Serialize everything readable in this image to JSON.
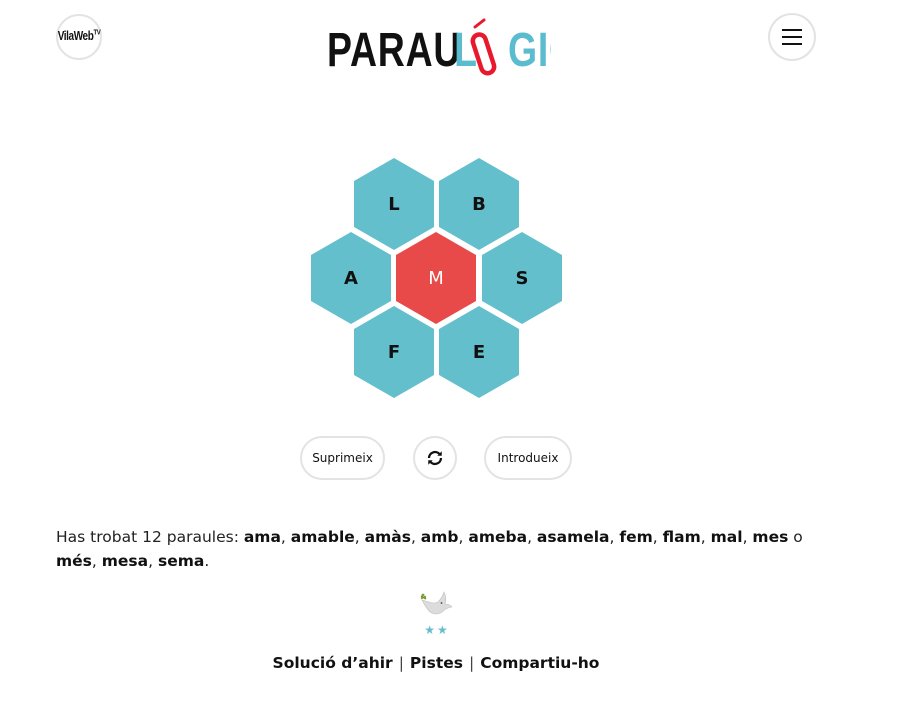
{
  "header": {
    "left_logo_text": "VilaWeb",
    "left_logo_mark": "TV",
    "logo_text": "PARAULÒGIC",
    "menu_icon": "hamburger-menu-icon"
  },
  "colors": {
    "outer_hex": "#64bfcd",
    "center_hex": "#e84a4a",
    "logo_accent": "#5bbcd0",
    "logo_clip": "#e8192c"
  },
  "puzzle": {
    "center_letter": "M",
    "letters": {
      "top_left": "L",
      "top_right": "B",
      "left": "A",
      "right": "S",
      "bottom_left": "F",
      "bottom_right": "E"
    }
  },
  "actions": {
    "delete_label": "Suprimeix",
    "shuffle_icon": "shuffle-icon",
    "enter_label": "Introdueix"
  },
  "found": {
    "intro": "Has trobat 12 paraules: ",
    "words": [
      "ama",
      "amable",
      "amàs",
      "amb",
      "ameba",
      "asamela",
      "fem",
      "flam",
      "mal",
      "mes",
      "més",
      "mesa",
      "sema"
    ],
    "conjunction": "o"
  },
  "rating": {
    "stars": "★★",
    "icon": "dove-icon"
  },
  "footer": {
    "yesterday": "Solució d’ahir",
    "hints": "Pistes",
    "share": "Compartiu-ho",
    "separator": "|"
  }
}
